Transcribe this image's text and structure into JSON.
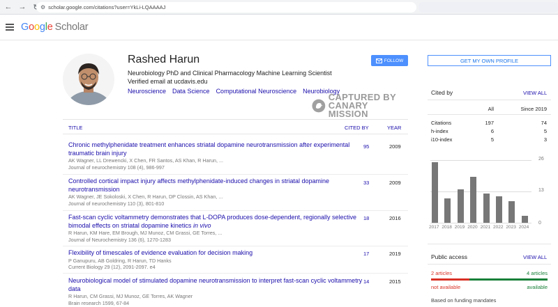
{
  "browser": {
    "url": "scholar.google.com/citations?user=YkLi-LQAAAAJ"
  },
  "header": {
    "logo": {
      "g1": "G",
      "o1": "o",
      "o2": "o",
      "g2": "g",
      "l": "l",
      "e": "e",
      "scholar": "Scholar"
    }
  },
  "profile": {
    "name": "Rashed Harun",
    "affiliation": "Neurobiology PhD and Clinical Pharmacology Machine Learning Scientist",
    "email": "Verified email at ucdavis.edu",
    "interests": [
      "Neuroscience",
      "Data Science",
      "Computational Neuroscience",
      "Neurobiology"
    ],
    "follow_label": "FOLLOW",
    "own_profile_label": "GET MY OWN PROFILE"
  },
  "watermark": {
    "line1": "CAPTURED BY",
    "line2": "CANARY MISSION"
  },
  "table": {
    "col_title": "TITLE",
    "col_cited": "CITED BY",
    "col_year": "YEAR",
    "rows": [
      {
        "title": "Chronic methylphenidate treatment enhances striatal dopamine neurotransmission after experimental traumatic brain injury",
        "authors": "AK Wagner, LL Drewencki, X Chen, FR Santos, AS Khan, R Harun, ...",
        "venue": "Journal of neurochemistry 108 (4), 986-997",
        "cites": "95",
        "year": "2009"
      },
      {
        "title": "Controlled cortical impact injury affects methylphenidate-induced changes in striatal dopamine neurotransmission",
        "authors": "AK Wagner, JE Sokoloski, X Chen, R Harun, DP Clossin, AS Khan, ...",
        "venue": "Journal of neurochemistry 110 (3), 801-810",
        "cites": "33",
        "year": "2009"
      },
      {
        "title": "Fast-scan cyclic voltammetry demonstrates that L-DOPA produces dose-dependent, regionally selective bimodal effects on striatal dopamine kinetics",
        "title_em": "in vivo",
        "authors": "R Harun, KM Hare, EM Brough, MJ Munoz, CM Grassi, GE Torres, ...",
        "venue": "Journal of Neurochemistry 136 (6), 1270-1283",
        "cites": "18",
        "year": "2016"
      },
      {
        "title": "Flexibility of timescales of evidence evaluation for decision making",
        "authors": "P Ganupuru, AB Goldring, R Harun, TD Hanks",
        "venue": "Current Biology 29 (12), 2091-2097. e4",
        "cites": "17",
        "year": "2019"
      },
      {
        "title": "Neurobiological model of stimulated dopamine neurotransmission to interpret fast-scan cyclic voltammetry data",
        "authors": "R Harun, CM Grassi, MJ Munoz, GE Torres, AK Wagner",
        "venue": "Brain research 1599, 67-84",
        "cites": "14",
        "year": "2015"
      }
    ]
  },
  "cited_by": {
    "title": "Cited by",
    "view_all": "VIEW ALL",
    "col_all": "All",
    "col_since": "Since 2019",
    "stats": [
      {
        "label": "Citations",
        "all": "197",
        "since": "74"
      },
      {
        "label": "h-index",
        "all": "6",
        "since": "5"
      },
      {
        "label": "i10-index",
        "all": "5",
        "since": "3"
      }
    ]
  },
  "chart_data": {
    "type": "bar",
    "categories": [
      "2017",
      "2018",
      "2019",
      "2020",
      "2021",
      "2022",
      "2023",
      "2024"
    ],
    "values": [
      25,
      10,
      14,
      19,
      12,
      11,
      9,
      3
    ],
    "yticks": [
      "26",
      "13",
      "0"
    ],
    "ylim": [
      0,
      26
    ]
  },
  "public_access": {
    "title": "Public access",
    "view_all": "VIEW ALL",
    "unavailable_count": "2 articles",
    "available_count": "4 articles",
    "unavailable_label": "not available",
    "available_label": "available",
    "unavailable_fraction": 0.33,
    "funding": "Based on funding mandates",
    "colors": {
      "unavailable": "#d93025",
      "available": "#188038"
    }
  }
}
